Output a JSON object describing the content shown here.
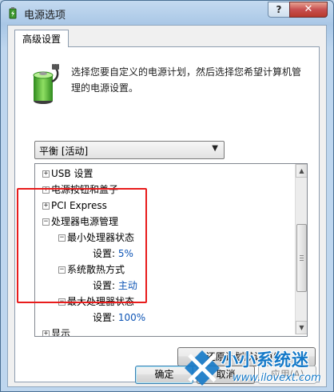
{
  "window": {
    "title": "电源选项",
    "help_label": "?",
    "close_label": "✕"
  },
  "tab": {
    "label": "高级设置"
  },
  "description": "选择您要自定义的电源计划，然后选择您希望计算机管理的电源设置。",
  "plan_select": {
    "value": "平衡 [活动]"
  },
  "tree": [
    {
      "label": "USB 设置",
      "expander": "+"
    },
    {
      "label": "电源按钮和盖子",
      "expander": "+"
    },
    {
      "label": "PCI Express",
      "expander": "+"
    },
    {
      "label": "处理器电源管理",
      "expander": "−"
    },
    {
      "label": "最小处理器状态",
      "expander": "−"
    },
    {
      "label": "设置:",
      "value": "5%"
    },
    {
      "label": "系统散热方式",
      "expander": "−"
    },
    {
      "label": "设置:",
      "value": "主动"
    },
    {
      "label": "最大处理器状态",
      "expander": "−"
    },
    {
      "label": "设置:",
      "value": "100%"
    },
    {
      "label": "显示",
      "expander": "+"
    }
  ],
  "buttons": {
    "restore": "还原计划默认值(R)",
    "ok": "确定",
    "cancel": "取消",
    "apply": "应用(A)"
  },
  "watermark": {
    "name": "小小系统迷",
    "url": "www.ilovext.com"
  },
  "colors": {
    "value_text": "#0d54b5",
    "highlight": "#e81c1c",
    "watermark": "#1479c8"
  }
}
